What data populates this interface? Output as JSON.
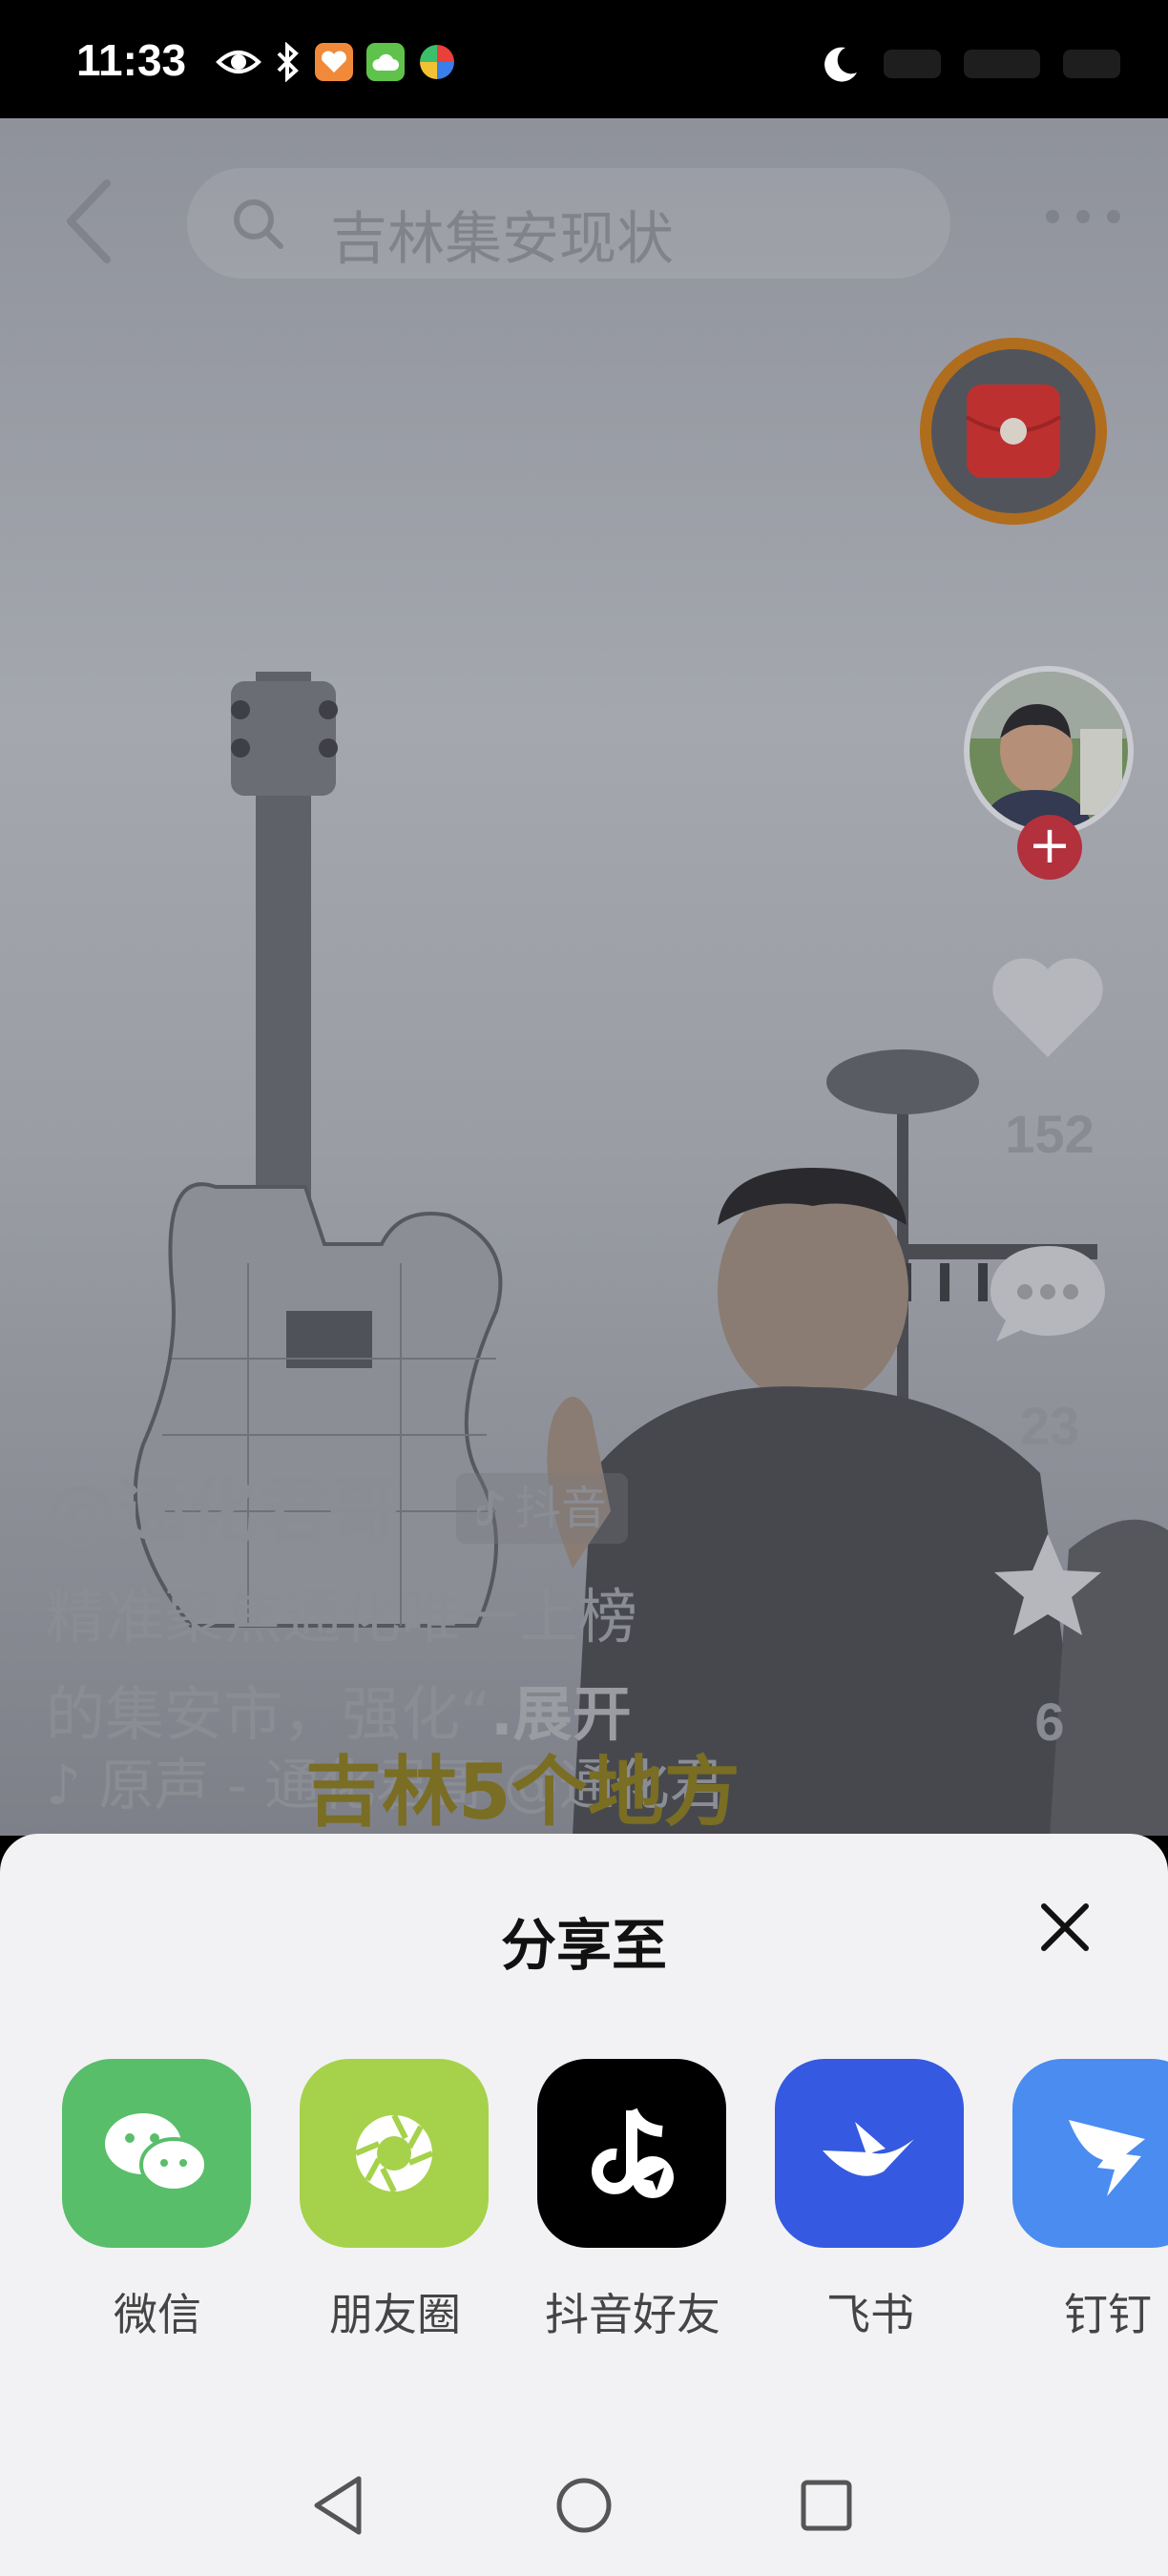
{
  "status_bar": {
    "time": "11:33",
    "icons": [
      "eye-icon",
      "bluetooth-icon",
      "heart-app-icon",
      "cloud-app-icon",
      "pinwheel-app-icon"
    ],
    "right_icons": [
      "moon-icon",
      "signal-icon",
      "battery-icon"
    ]
  },
  "top_bar": {
    "search_text": "吉林集安现状"
  },
  "side_actions": {
    "like_count": "152",
    "comment_count": "23",
    "favorite_count": "6"
  },
  "video_info": {
    "author": "@通化君哥",
    "platform_tag": "抖音",
    "description_line1": "精准聚焦通化唯一上榜",
    "description_line2": "的集安市，强化“",
    "more_label": ".展开",
    "music_line": "♪ 原声 - 通化君哥 @通化君",
    "caption_text": "吉林5个地方"
  },
  "share_sheet": {
    "title": "分享至",
    "apps": [
      {
        "label": "微信",
        "color": "#58be6a"
      },
      {
        "label": "朋友圈",
        "color": "#a5d24a"
      },
      {
        "label": "抖音好友",
        "color": "#000000"
      },
      {
        "label": "飞书",
        "color": "#3559e0"
      },
      {
        "label": "钉钉",
        "color": "#4a8cf0"
      }
    ]
  }
}
